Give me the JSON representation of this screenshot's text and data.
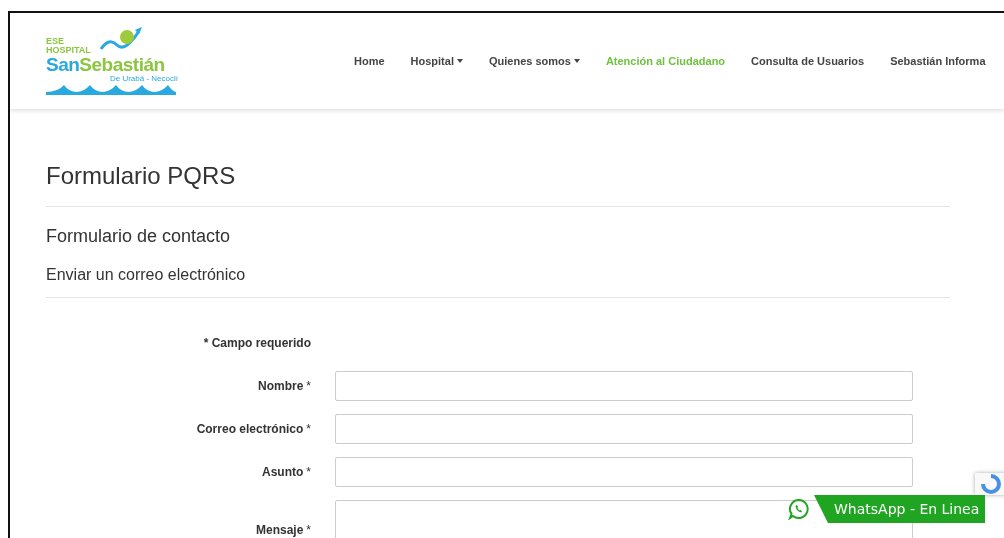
{
  "logo": {
    "line_1": "ESE",
    "line_2": "HOSPITAL",
    "name_part_1": "San",
    "name_part_2": "Sebastián",
    "subtitle": "De Urabá - Necoclí"
  },
  "nav": [
    {
      "label": "Home",
      "has_menu": false,
      "selected": false
    },
    {
      "label": "Hospital",
      "has_menu": true,
      "selected": false
    },
    {
      "label": "Quienes somos",
      "has_menu": true,
      "selected": false
    },
    {
      "label": "Atención al Ciudadano",
      "has_menu": false,
      "selected": true
    },
    {
      "label": "Consulta de Usuarios",
      "has_menu": false,
      "selected": false
    },
    {
      "label": "Sebastián Informa",
      "has_menu": false,
      "selected": false
    }
  ],
  "page_title": "Formulario PQRS",
  "form_title": "Formulario de contacto",
  "section_title": "Enviar un correo electrónico",
  "required_note": "* Campo requerido",
  "fields": [
    {
      "label": "Nombre",
      "required_mark": "*",
      "kind": "input"
    },
    {
      "label": "Correo electrónico",
      "required_mark": "*",
      "kind": "input"
    },
    {
      "label": "Asunto",
      "required_mark": "*",
      "kind": "input"
    },
    {
      "label": "Mensaje",
      "required_mark": "*",
      "kind": "textarea"
    }
  ],
  "whatsapp": {
    "label": "WhatsApp - En Linea"
  }
}
